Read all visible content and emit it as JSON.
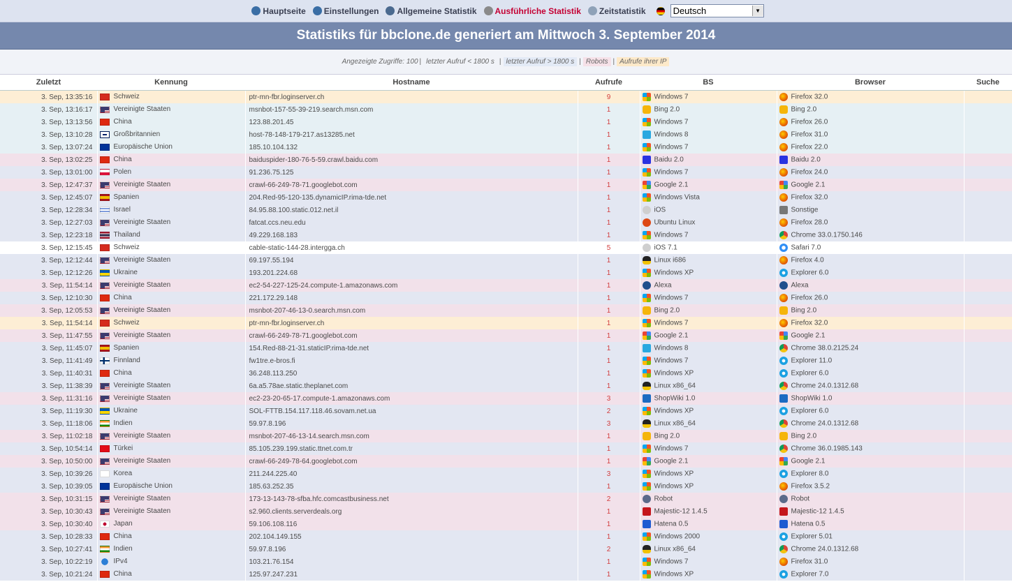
{
  "nav": {
    "items": [
      {
        "label": "Hauptseite",
        "icon": "home-globe-icon",
        "color": "#3a6ea5",
        "active": false
      },
      {
        "label": "Einstellungen",
        "icon": "settings-globe-icon",
        "color": "#3a6ea5",
        "active": false
      },
      {
        "label": "Allgemeine Statistik",
        "icon": "general-stats-icon",
        "color": "#4b6a8f",
        "active": false
      },
      {
        "label": "Ausführliche Statistik",
        "icon": "detailed-stats-icon",
        "color": "#8a8a8a",
        "active": true
      },
      {
        "label": "Zeitstatistik",
        "icon": "clock-icon",
        "color": "#8fa2b8",
        "active": false
      }
    ],
    "language": "Deutsch"
  },
  "banner_title": "Statistiks für bbclone.de generiert am Mittwoch 3. September 2014",
  "filters": {
    "shown": "Angezeigte Zugriffe: 100",
    "last_lt": "letzter Aufruf < 1800 s",
    "last_gt": "letzter Aufruf > 1800 s",
    "robots": "Robots",
    "own_ip": "Aufrufe ihrer IP"
  },
  "columns": {
    "time": "Zuletzt",
    "id": "Kennung",
    "host": "Hostname",
    "hits": "Aufrufe",
    "os": "BS",
    "browser": "Browser",
    "search": "Suche"
  },
  "colors": {
    "blue": "#e3e7f2",
    "pink": "#f2e1ea",
    "peach": "#fdeed5",
    "light": "#e6f0f4",
    "hits": "#d23c3c"
  },
  "rows": [
    {
      "time": "3. Sep, 13:35:16",
      "country": "Schweiz",
      "flag": "ch",
      "host": "ptr-mn-fbr.loginserver.ch",
      "hits": "9",
      "os": "Windows 7",
      "os_icon": "windows",
      "browser": "Firefox 32.0",
      "br_icon": "firefox",
      "bg": "peach"
    },
    {
      "time": "3. Sep, 13:16:17",
      "country": "Vereinigte Staaten",
      "flag": "us",
      "host": "msnbot-157-55-39-219.search.msn.com",
      "hits": "1",
      "os": "Bing 2.0",
      "os_icon": "bing",
      "browser": "Bing 2.0",
      "br_icon": "bing",
      "bg": "light"
    },
    {
      "time": "3. Sep, 13:13:56",
      "country": "China",
      "flag": "cn",
      "host": "123.88.201.45",
      "hits": "1",
      "os": "Windows 7",
      "os_icon": "windows",
      "browser": "Firefox 26.0",
      "br_icon": "firefox",
      "bg": "light"
    },
    {
      "time": "3. Sep, 13:10:28",
      "country": "Großbritannien",
      "flag": "gb",
      "host": "host-78-148-179-217.as13285.net",
      "hits": "1",
      "os": "Windows 8",
      "os_icon": "windows8",
      "browser": "Firefox 31.0",
      "br_icon": "firefox",
      "bg": "light"
    },
    {
      "time": "3. Sep, 13:07:24",
      "country": "Europäische Union",
      "flag": "eu",
      "host": "185.10.104.132",
      "hits": "1",
      "os": "Windows 7",
      "os_icon": "windows",
      "browser": "Firefox 22.0",
      "br_icon": "firefox",
      "bg": "light"
    },
    {
      "time": "3. Sep, 13:02:25",
      "country": "China",
      "flag": "cn",
      "host": "baiduspider-180-76-5-59.crawl.baidu.com",
      "hits": "1",
      "os": "Baidu 2.0",
      "os_icon": "baidu",
      "browser": "Baidu 2.0",
      "br_icon": "baidu",
      "bg": "pink"
    },
    {
      "time": "3. Sep, 13:01:00",
      "country": "Polen",
      "flag": "pl",
      "host": "91.236.75.125",
      "hits": "1",
      "os": "Windows 7",
      "os_icon": "windows",
      "browser": "Firefox 24.0",
      "br_icon": "firefox",
      "bg": "blue"
    },
    {
      "time": "3. Sep, 12:47:37",
      "country": "Vereinigte Staaten",
      "flag": "us",
      "host": "crawl-66-249-78-71.googlebot.com",
      "hits": "1",
      "os": "Google 2.1",
      "os_icon": "google",
      "browser": "Google 2.1",
      "br_icon": "google",
      "bg": "pink"
    },
    {
      "time": "3. Sep, 12:45:07",
      "country": "Spanien",
      "flag": "es",
      "host": "204.Red-95-120-135.dynamicIP.rima-tde.net",
      "hits": "1",
      "os": "Windows Vista",
      "os_icon": "windows",
      "browser": "Firefox 32.0",
      "br_icon": "firefox",
      "bg": "blue"
    },
    {
      "time": "3. Sep, 12:28:34",
      "country": "Israel",
      "flag": "il",
      "host": "84.95.88.100.static.012.net.il",
      "hits": "1",
      "os": "iOS",
      "os_icon": "apple",
      "browser": "Sonstige",
      "br_icon": "unknown",
      "bg": "blue"
    },
    {
      "time": "3. Sep, 12:27:03",
      "country": "Vereinigte Staaten",
      "flag": "us",
      "host": "fatcat.ccs.neu.edu",
      "hits": "1",
      "os": "Ubuntu Linux",
      "os_icon": "ubuntu",
      "browser": "Firefox 28.0",
      "br_icon": "firefox",
      "bg": "blue"
    },
    {
      "time": "3. Sep, 12:23:18",
      "country": "Thailand",
      "flag": "th",
      "host": "49.229.168.183",
      "hits": "1",
      "os": "Windows 7",
      "os_icon": "windows",
      "browser": "Chrome 33.0.1750.146",
      "br_icon": "chrome",
      "bg": "blue"
    },
    {
      "time": "3. Sep, 12:15:45",
      "country": "Schweiz",
      "flag": "ch",
      "host": "cable-static-144-28.intergga.ch",
      "hits": "5",
      "os": "iOS 7.1",
      "os_icon": "apple",
      "browser": "Safari 7.0",
      "br_icon": "safari",
      "bg": "white"
    },
    {
      "time": "3. Sep, 12:12:44",
      "country": "Vereinigte Staaten",
      "flag": "us",
      "host": "69.197.55.194",
      "hits": "1",
      "os": "Linux i686",
      "os_icon": "linux",
      "browser": "Firefox 4.0",
      "br_icon": "firefox",
      "bg": "blue"
    },
    {
      "time": "3. Sep, 12:12:26",
      "country": "Ukraine",
      "flag": "ua",
      "host": "193.201.224.68",
      "hits": "1",
      "os": "Windows XP",
      "os_icon": "windows",
      "browser": "Explorer 6.0",
      "br_icon": "explorer",
      "bg": "blue"
    },
    {
      "time": "3. Sep, 11:54:14",
      "country": "Vereinigte Staaten",
      "flag": "us",
      "host": "ec2-54-227-125-24.compute-1.amazonaws.com",
      "hits": "1",
      "os": "Alexa",
      "os_icon": "alexa",
      "browser": "Alexa",
      "br_icon": "alexa",
      "bg": "pink"
    },
    {
      "time": "3. Sep, 12:10:30",
      "country": "China",
      "flag": "cn",
      "host": "221.172.29.148",
      "hits": "1",
      "os": "Windows 7",
      "os_icon": "windows",
      "browser": "Firefox 26.0",
      "br_icon": "firefox",
      "bg": "blue"
    },
    {
      "time": "3. Sep, 12:05:53",
      "country": "Vereinigte Staaten",
      "flag": "us",
      "host": "msnbot-207-46-13-0.search.msn.com",
      "hits": "1",
      "os": "Bing 2.0",
      "os_icon": "bing",
      "browser": "Bing 2.0",
      "br_icon": "bing",
      "bg": "pink"
    },
    {
      "time": "3. Sep, 11:54:14",
      "country": "Schweiz",
      "flag": "ch",
      "host": "ptr-mn-fbr.loginserver.ch",
      "hits": "1",
      "os": "Windows 7",
      "os_icon": "windows",
      "browser": "Firefox 32.0",
      "br_icon": "firefox",
      "bg": "peach"
    },
    {
      "time": "3. Sep, 11:47:55",
      "country": "Vereinigte Staaten",
      "flag": "us",
      "host": "crawl-66-249-78-71.googlebot.com",
      "hits": "1",
      "os": "Google 2.1",
      "os_icon": "google",
      "browser": "Google 2.1",
      "br_icon": "google",
      "bg": "pink"
    },
    {
      "time": "3. Sep, 11:45:07",
      "country": "Spanien",
      "flag": "es",
      "host": "154.Red-88-21-31.staticIP.rima-tde.net",
      "hits": "1",
      "os": "Windows 8",
      "os_icon": "windows8",
      "browser": "Chrome 38.0.2125.24",
      "br_icon": "chrome",
      "bg": "blue"
    },
    {
      "time": "3. Sep, 11:41:49",
      "country": "Finnland",
      "flag": "fi",
      "host": "fw1tre.e-bros.fi",
      "hits": "1",
      "os": "Windows 7",
      "os_icon": "windows",
      "browser": "Explorer 11.0",
      "br_icon": "explorer",
      "bg": "blue"
    },
    {
      "time": "3. Sep, 11:40:31",
      "country": "China",
      "flag": "cn",
      "host": "36.248.113.250",
      "hits": "1",
      "os": "Windows XP",
      "os_icon": "windows",
      "browser": "Explorer 6.0",
      "br_icon": "explorer",
      "bg": "blue"
    },
    {
      "time": "3. Sep, 11:38:39",
      "country": "Vereinigte Staaten",
      "flag": "us",
      "host": "6a.a5.78ae.static.theplanet.com",
      "hits": "1",
      "os": "Linux x86_64",
      "os_icon": "linux",
      "browser": "Chrome 24.0.1312.68",
      "br_icon": "chrome",
      "bg": "blue"
    },
    {
      "time": "3. Sep, 11:31:16",
      "country": "Vereinigte Staaten",
      "flag": "us",
      "host": "ec2-23-20-65-17.compute-1.amazonaws.com",
      "hits": "3",
      "os": "ShopWiki 1.0",
      "os_icon": "shopwiki",
      "browser": "ShopWiki 1.0",
      "br_icon": "shopwiki",
      "bg": "pink"
    },
    {
      "time": "3. Sep, 11:19:30",
      "country": "Ukraine",
      "flag": "ua",
      "host": "SOL-FTTB.154.117.118.46.sovam.net.ua",
      "hits": "2",
      "os": "Windows XP",
      "os_icon": "windows",
      "browser": "Explorer 6.0",
      "br_icon": "explorer",
      "bg": "blue"
    },
    {
      "time": "3. Sep, 11:18:06",
      "country": "Indien",
      "flag": "in",
      "host": "59.97.8.196",
      "hits": "3",
      "os": "Linux x86_64",
      "os_icon": "linux",
      "browser": "Chrome 24.0.1312.68",
      "br_icon": "chrome",
      "bg": "blue"
    },
    {
      "time": "3. Sep, 11:02:18",
      "country": "Vereinigte Staaten",
      "flag": "us",
      "host": "msnbot-207-46-13-14.search.msn.com",
      "hits": "1",
      "os": "Bing 2.0",
      "os_icon": "bing",
      "browser": "Bing 2.0",
      "br_icon": "bing",
      "bg": "pink"
    },
    {
      "time": "3. Sep, 10:54:14",
      "country": "Türkei",
      "flag": "tr",
      "host": "85.105.239.199.static.ttnet.com.tr",
      "hits": "1",
      "os": "Windows 7",
      "os_icon": "windows",
      "browser": "Chrome 36.0.1985.143",
      "br_icon": "chrome",
      "bg": "blue"
    },
    {
      "time": "3. Sep, 10:50:00",
      "country": "Vereinigte Staaten",
      "flag": "us",
      "host": "crawl-66-249-78-64.googlebot.com",
      "hits": "1",
      "os": "Google 2.1",
      "os_icon": "google",
      "browser": "Google 2.1",
      "br_icon": "google",
      "bg": "pink"
    },
    {
      "time": "3. Sep, 10:39:26",
      "country": "Korea",
      "flag": "kr",
      "host": "211.244.225.40",
      "hits": "3",
      "os": "Windows XP",
      "os_icon": "windows",
      "browser": "Explorer 8.0",
      "br_icon": "explorer",
      "bg": "blue"
    },
    {
      "time": "3. Sep, 10:39:05",
      "country": "Europäische Union",
      "flag": "eu",
      "host": "185.63.252.35",
      "hits": "1",
      "os": "Windows XP",
      "os_icon": "windows",
      "browser": "Firefox 3.5.2",
      "br_icon": "firefox",
      "bg": "blue"
    },
    {
      "time": "3. Sep, 10:31:15",
      "country": "Vereinigte Staaten",
      "flag": "us",
      "host": "173-13-143-78-sfba.hfc.comcastbusiness.net",
      "hits": "2",
      "os": "Robot",
      "os_icon": "robot",
      "browser": "Robot",
      "br_icon": "robot",
      "bg": "pink"
    },
    {
      "time": "3. Sep, 10:30:43",
      "country": "Vereinigte Staaten",
      "flag": "us",
      "host": "s2.960.clients.serverdeals.org",
      "hits": "1",
      "os": "Majestic-12 1.4.5",
      "os_icon": "majestic",
      "browser": "Majestic-12 1.4.5",
      "br_icon": "majestic",
      "bg": "pink"
    },
    {
      "time": "3. Sep, 10:30:40",
      "country": "Japan",
      "flag": "jp",
      "host": "59.106.108.116",
      "hits": "1",
      "os": "Hatena 0.5",
      "os_icon": "hatena",
      "browser": "Hatena 0.5",
      "br_icon": "hatena",
      "bg": "pink"
    },
    {
      "time": "3. Sep, 10:28:33",
      "country": "China",
      "flag": "cn",
      "host": "202.104.149.155",
      "hits": "1",
      "os": "Windows 2000",
      "os_icon": "windows",
      "browser": "Explorer 5.01",
      "br_icon": "explorer",
      "bg": "blue"
    },
    {
      "time": "3. Sep, 10:27:41",
      "country": "Indien",
      "flag": "in",
      "host": "59.97.8.196",
      "hits": "2",
      "os": "Linux x86_64",
      "os_icon": "linux",
      "browser": "Chrome 24.0.1312.68",
      "br_icon": "chrome",
      "bg": "blue"
    },
    {
      "time": "3. Sep, 10:22:19",
      "country": "IPv4",
      "flag": "ipv4",
      "host": "103.21.76.154",
      "hits": "1",
      "os": "Windows 7",
      "os_icon": "windows",
      "browser": "Firefox 31.0",
      "br_icon": "firefox",
      "bg": "blue"
    },
    {
      "time": "3. Sep, 10:21:24",
      "country": "China",
      "flag": "cn",
      "host": "125.97.247.231",
      "hits": "1",
      "os": "Windows XP",
      "os_icon": "windows",
      "browser": "Explorer 7.0",
      "br_icon": "explorer",
      "bg": "blue"
    }
  ]
}
